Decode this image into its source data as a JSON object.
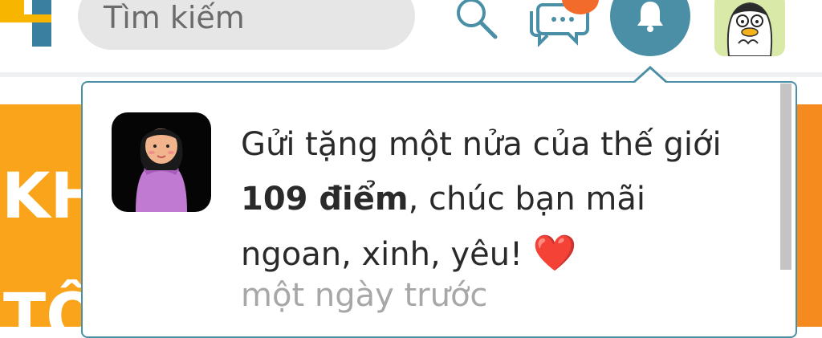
{
  "header": {
    "search_placeholder": "Tìm kiếm"
  },
  "background": {
    "left_text_1": "KH",
    "left_text_2": "TÔ"
  },
  "notification": {
    "line_prefix": "Gửi tặng một nửa của thế giới",
    "points": "109 điểm",
    "line_suffix": ", chúc bạn mãi ngoan, xinh, yêu!",
    "emoji": "❤️",
    "time": "một ngày trước"
  },
  "colors": {
    "accent": "#4a8fa6",
    "badge": "#f26b2b",
    "banner": "#f9a41b"
  }
}
